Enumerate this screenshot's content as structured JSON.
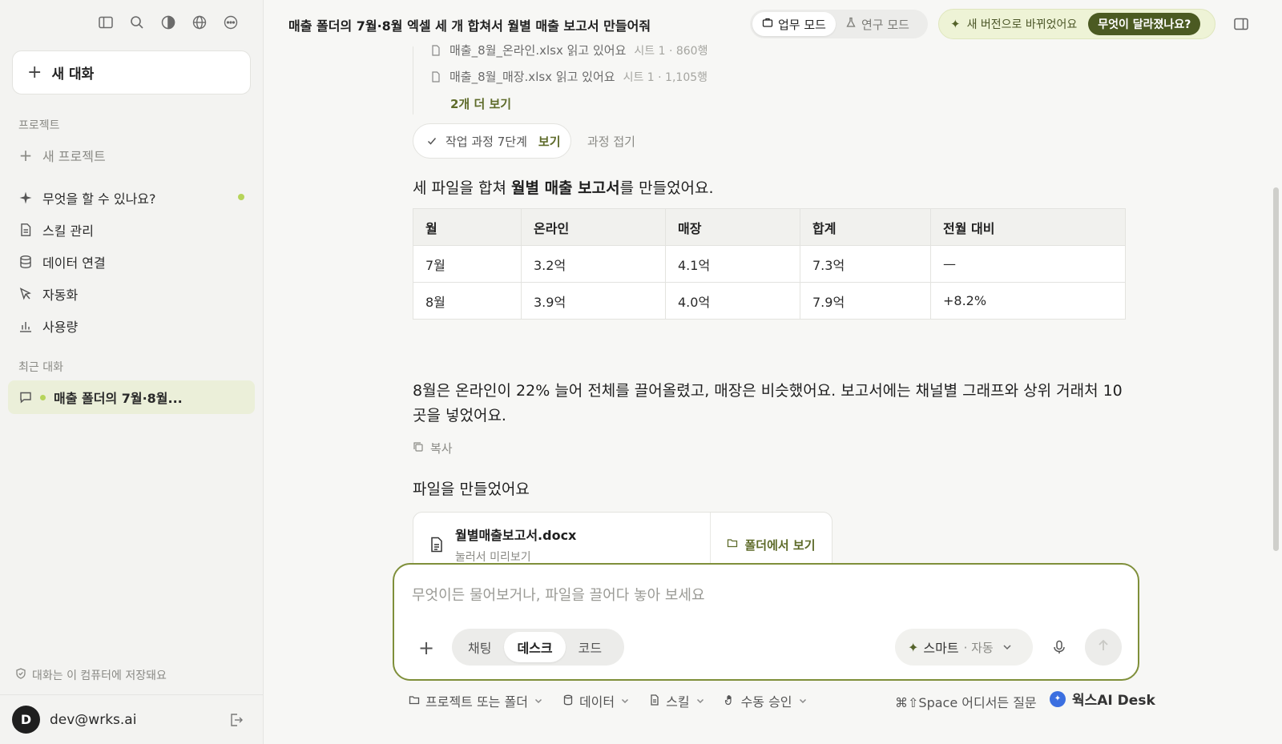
{
  "sidebar": {
    "new_chat_label": "새 대화",
    "projects_heading": "프로젝트",
    "new_project_label": "새 프로젝트",
    "nav": [
      {
        "label": "무엇을 할 수 있나요?",
        "icon": "sparkle-icon"
      },
      {
        "label": "스킬 관리",
        "icon": "document-icon"
      },
      {
        "label": "데이터 연결",
        "icon": "database-icon"
      },
      {
        "label": "자동화",
        "icon": "cursor-icon"
      },
      {
        "label": "사용량",
        "icon": "bar-chart-icon"
      }
    ],
    "recent_heading": "최근 대화",
    "recent_item": "매출 폴더의 7월·8월...",
    "local_note": "대화는 이 컴퓨터에 저장돼요",
    "user_initial": "D",
    "user_email": "dev@wrks.ai"
  },
  "header": {
    "title": "매출 폴더의 7월·8월 엑셀 세 개 합쳐서 월별 매출 보고서 만들어줘",
    "mode_work": "업무 모드",
    "mode_research": "연구 모드",
    "update_text": "새 버전으로 바뀌었어요",
    "whatsnew_label": "무엇이 달라졌나요?"
  },
  "steps": {
    "files": [
      {
        "name": "매출_8월_온라인.xlsx 읽고 있어요",
        "meta": "시트 1 · 860행"
      },
      {
        "name": "매출_8월_매장.xlsx 읽고 있어요",
        "meta": "시트 1 · 1,105행"
      }
    ],
    "more_label": "2개 더 보기",
    "pill_label": "작업 과정 7단계",
    "pill_view": "보기",
    "collapse_label": "과정 접기"
  },
  "answer": {
    "summary_pre": "세 파일을 합쳐 ",
    "summary_bold": "월별 매출 보고서",
    "summary_post": "를 만들었어요.",
    "table": {
      "headers": [
        "월",
        "온라인",
        "매장",
        "합계",
        "전월 대비"
      ],
      "rows": [
        [
          "7월",
          "3.2억",
          "4.1억",
          "7.3억",
          "—"
        ],
        [
          "8월",
          "3.9억",
          "4.0억",
          "7.9억",
          "+8.2%"
        ]
      ]
    },
    "analysis": "8월은 온라인이 22% 늘어 전체를 끌어올렸고, 매장은 비슷했어요. 보고서에는 채널별 그래프와 상위 거래처 10곳을 넣었어요.",
    "copy_label": "복사",
    "files_made": "파일을 만들었어요",
    "file_name": "월별매출보고서.docx",
    "file_sub": "눌러서 미리보기",
    "open_folder_label": "폴더에서 보기"
  },
  "composer": {
    "placeholder": "무엇이든 물어보거나, 파일을 끌어다 놓아 보세요",
    "modes": [
      "채팅",
      "데스크",
      "코드"
    ],
    "active_mode": "데스크",
    "model": "스마트",
    "model_auto": "· 자동"
  },
  "bottom_bar": {
    "project_or_folder": "프로젝트 또는 폴더",
    "data": "데이터",
    "skill": "스킬",
    "approval": "수동 승인",
    "shortcut": "⌘⇧Space 어디서든 질문",
    "brand": "웍스AI Desk"
  },
  "colors": {
    "accent": "#5e6b2a",
    "composer_border": "#7f8f3a",
    "highlight": "#ebefd9",
    "status_dot": "#b6d45a"
  }
}
